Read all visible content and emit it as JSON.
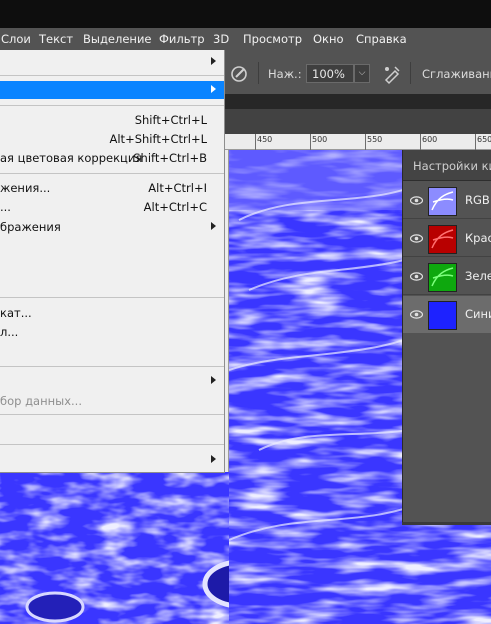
{
  "menubar": {
    "items": [
      "Слои",
      "Текст",
      "Выделение",
      "Фильтр",
      "3D",
      "Просмотр",
      "Окно",
      "Справка"
    ]
  },
  "options": {
    "pressure_label": "Наж.:",
    "pressure_value": "100%",
    "smoothing_label": "Сглаживани"
  },
  "ruler": {
    "ticks": [
      "450",
      "500",
      "550",
      "600",
      "650"
    ]
  },
  "dropdown": {
    "items": [
      {
        "label": "",
        "shortcut": "",
        "submenu": true
      },
      {
        "label": "",
        "shortcut": "",
        "submenu": true,
        "highlighted": true
      },
      {
        "label": "",
        "shortcut": "Shift+Ctrl+L"
      },
      {
        "label": "",
        "shortcut": "Alt+Shift+Ctrl+L"
      },
      {
        "label": "ая цветовая коррекция",
        "shortcut": "Shift+Ctrl+B"
      },
      {
        "label": "жения...",
        "shortcut": "Alt+Ctrl+I"
      },
      {
        "label": "...",
        "shortcut": "Alt+Ctrl+C"
      },
      {
        "label": "бражения",
        "shortcut": "",
        "submenu": true
      },
      {
        "label": "кат...",
        "shortcut": ""
      },
      {
        "label": "л...",
        "shortcut": ""
      },
      {
        "label": "",
        "shortcut": "",
        "submenu": true
      },
      {
        "label": "бор данных...",
        "shortcut": "",
        "disabled": true
      },
      {
        "label": "",
        "shortcut": "",
        "submenu": true
      }
    ]
  },
  "panel": {
    "title": "Настройки ки",
    "channels": [
      {
        "name": "RGB",
        "thumb": "rgb",
        "selected": false
      },
      {
        "name": "Крас",
        "thumb": "red",
        "selected": false
      },
      {
        "name": "Зеле",
        "thumb": "green",
        "selected": false
      },
      {
        "name": "Сини",
        "thumb": "blue",
        "selected": true
      }
    ]
  },
  "colors": {
    "highlight": "#0a84ff",
    "menubar": "#535353",
    "canvas_blue": "#3a36ff"
  }
}
